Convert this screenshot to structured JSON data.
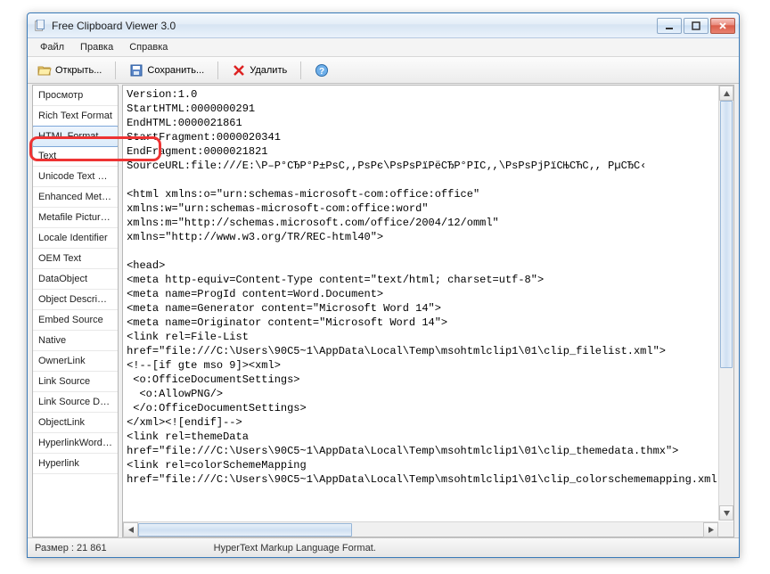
{
  "window": {
    "title": "Free Clipboard Viewer 3.0"
  },
  "menubar": {
    "items": [
      "Файл",
      "Правка",
      "Справка"
    ]
  },
  "toolbar": {
    "open": "Открыть...",
    "save": "Сохранить...",
    "delete": "Удалить"
  },
  "sidebar": {
    "items": [
      "Просмотр",
      "Rich Text Format",
      "HTML Format",
      "Text",
      "Unicode Text Format",
      "Enhanced Metafile",
      "Metafile Picture Format",
      "Locale Identifier",
      "OEM Text",
      "DataObject",
      "Object Descriptor",
      "Embed Source",
      "Native",
      "OwnerLink",
      "Link Source",
      "Link Source Descriptor",
      "ObjectLink",
      "HyperlinkWordBkmk",
      "Hyperlink"
    ],
    "selected_index": 2
  },
  "content": {
    "text": "Version:1.0\nStartHTML:0000000291\nEndHTML:0000021861\nStartFragment:0000020341\nEndFragment:0000021821\nSourceURL:file:///E:\\Р–Р°СЂР°Р±РѕС‚,РѕРє\\РѕРѕРїРёСЂР°РІС‚,\\РѕРѕРјРїСЊСЋС‚, РµСЂС‹\n\n<html xmlns:o=\"urn:schemas-microsoft-com:office:office\"\nxmlns:w=\"urn:schemas-microsoft-com:office:word\"\nxmlns:m=\"http://schemas.microsoft.com/office/2004/12/omml\"\nxmlns=\"http://www.w3.org/TR/REC-html40\">\n\n<head>\n<meta http-equiv=Content-Type content=\"text/html; charset=utf-8\">\n<meta name=ProgId content=Word.Document>\n<meta name=Generator content=\"Microsoft Word 14\">\n<meta name=Originator content=\"Microsoft Word 14\">\n<link rel=File-List\nhref=\"file:///C:\\Users\\90C5~1\\AppData\\Local\\Temp\\msohtmlclip1\\01\\clip_filelist.xml\">\n<!--[if gte mso 9]><xml>\n <o:OfficeDocumentSettings>\n  <o:AllowPNG/>\n </o:OfficeDocumentSettings>\n</xml><![endif]-->\n<link rel=themeData\nhref=\"file:///C:\\Users\\90C5~1\\AppData\\Local\\Temp\\msohtmlclip1\\01\\clip_themedata.thmx\">\n<link rel=colorSchemeMapping\nhref=\"file:///C:\\Users\\90C5~1\\AppData\\Local\\Temp\\msohtmlclip1\\01\\clip_colorschememapping.xml\">"
  },
  "statusbar": {
    "size": "Размер : 21 861",
    "desc": "HyperText Markup Language Format."
  }
}
